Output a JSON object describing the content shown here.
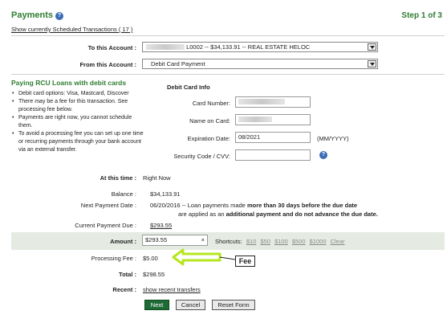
{
  "header": {
    "title": "Payments",
    "step": "Step 1 of 3",
    "scheduled_link": "Show currently Scheduled Transactions ( 17 )"
  },
  "to_account": {
    "label": "To this Account :",
    "value": "L0002  --  $34,133.91  --  REAL ESTATE HELOC"
  },
  "from_account": {
    "label": "From this Account :",
    "value": "Debit Card Payment"
  },
  "sidebar": {
    "title": "Paying RCU Loans with debit cards",
    "bullets": [
      "Debit card options: Visa, Mastcard, Discover",
      "There may be a fee for this transaction. See processing fee below.",
      "Payments are right now, you cannot schedule them.",
      "To avoid a processing fee you can set up one time or recurring payments through your bank account via an external transfer."
    ]
  },
  "debit_card": {
    "heading": "Debit Card Info",
    "card_number_label": "Card Number:",
    "name_label": "Name on Card:",
    "expiration_label": "Expiration Date:",
    "expiration_value": "08/2021",
    "expiration_hint": "(MM/YYYY)",
    "cvv_label": "Security Code / CVV:"
  },
  "details": {
    "time_label": "At this time :",
    "time_value": "Right Now",
    "balance_label": "Balance :",
    "balance_value": "$34,133.91",
    "next_payment_label": "Next Payment Date :",
    "next_payment_value": "06/20/2016",
    "note_line1_pre": " -- Loan payments made ",
    "note_line1_bold": "more than 30 days before the due date",
    "note_line2_pre": "are applied as an ",
    "note_line2_bold": "additional payment and do not advance the due date.",
    "current_due_label": "Current Payment Due :",
    "current_due_value": "$293.55"
  },
  "amount": {
    "label": "Amount :",
    "value": "$293.55",
    "clear_glyph": "×",
    "shortcuts_label": "Shortcuts:",
    "shortcuts": [
      "$10",
      "$50",
      "$100",
      "$500",
      "$1000",
      "Clear"
    ]
  },
  "fee": {
    "label": "Processing Fee :",
    "value": "$5.00",
    "annotation": "Fee",
    "arrow_color": "#b5e61d"
  },
  "total": {
    "label": "Total :",
    "value": "$298.55"
  },
  "recent": {
    "label": "Recent :",
    "link": "show recent transfers"
  },
  "buttons": {
    "next": "Next",
    "cancel": "Cancel",
    "reset": "Reset Form"
  },
  "icons": {
    "help": "question-circle-icon",
    "cvv_help": "question-circle-icon",
    "dropdown": "chevron-down-icon"
  },
  "colors": {
    "brand_green": "#2e7d32",
    "next_button": "#1f6b36",
    "amount_band": "#e5ebe2",
    "help_blue": "#3b6db5"
  }
}
